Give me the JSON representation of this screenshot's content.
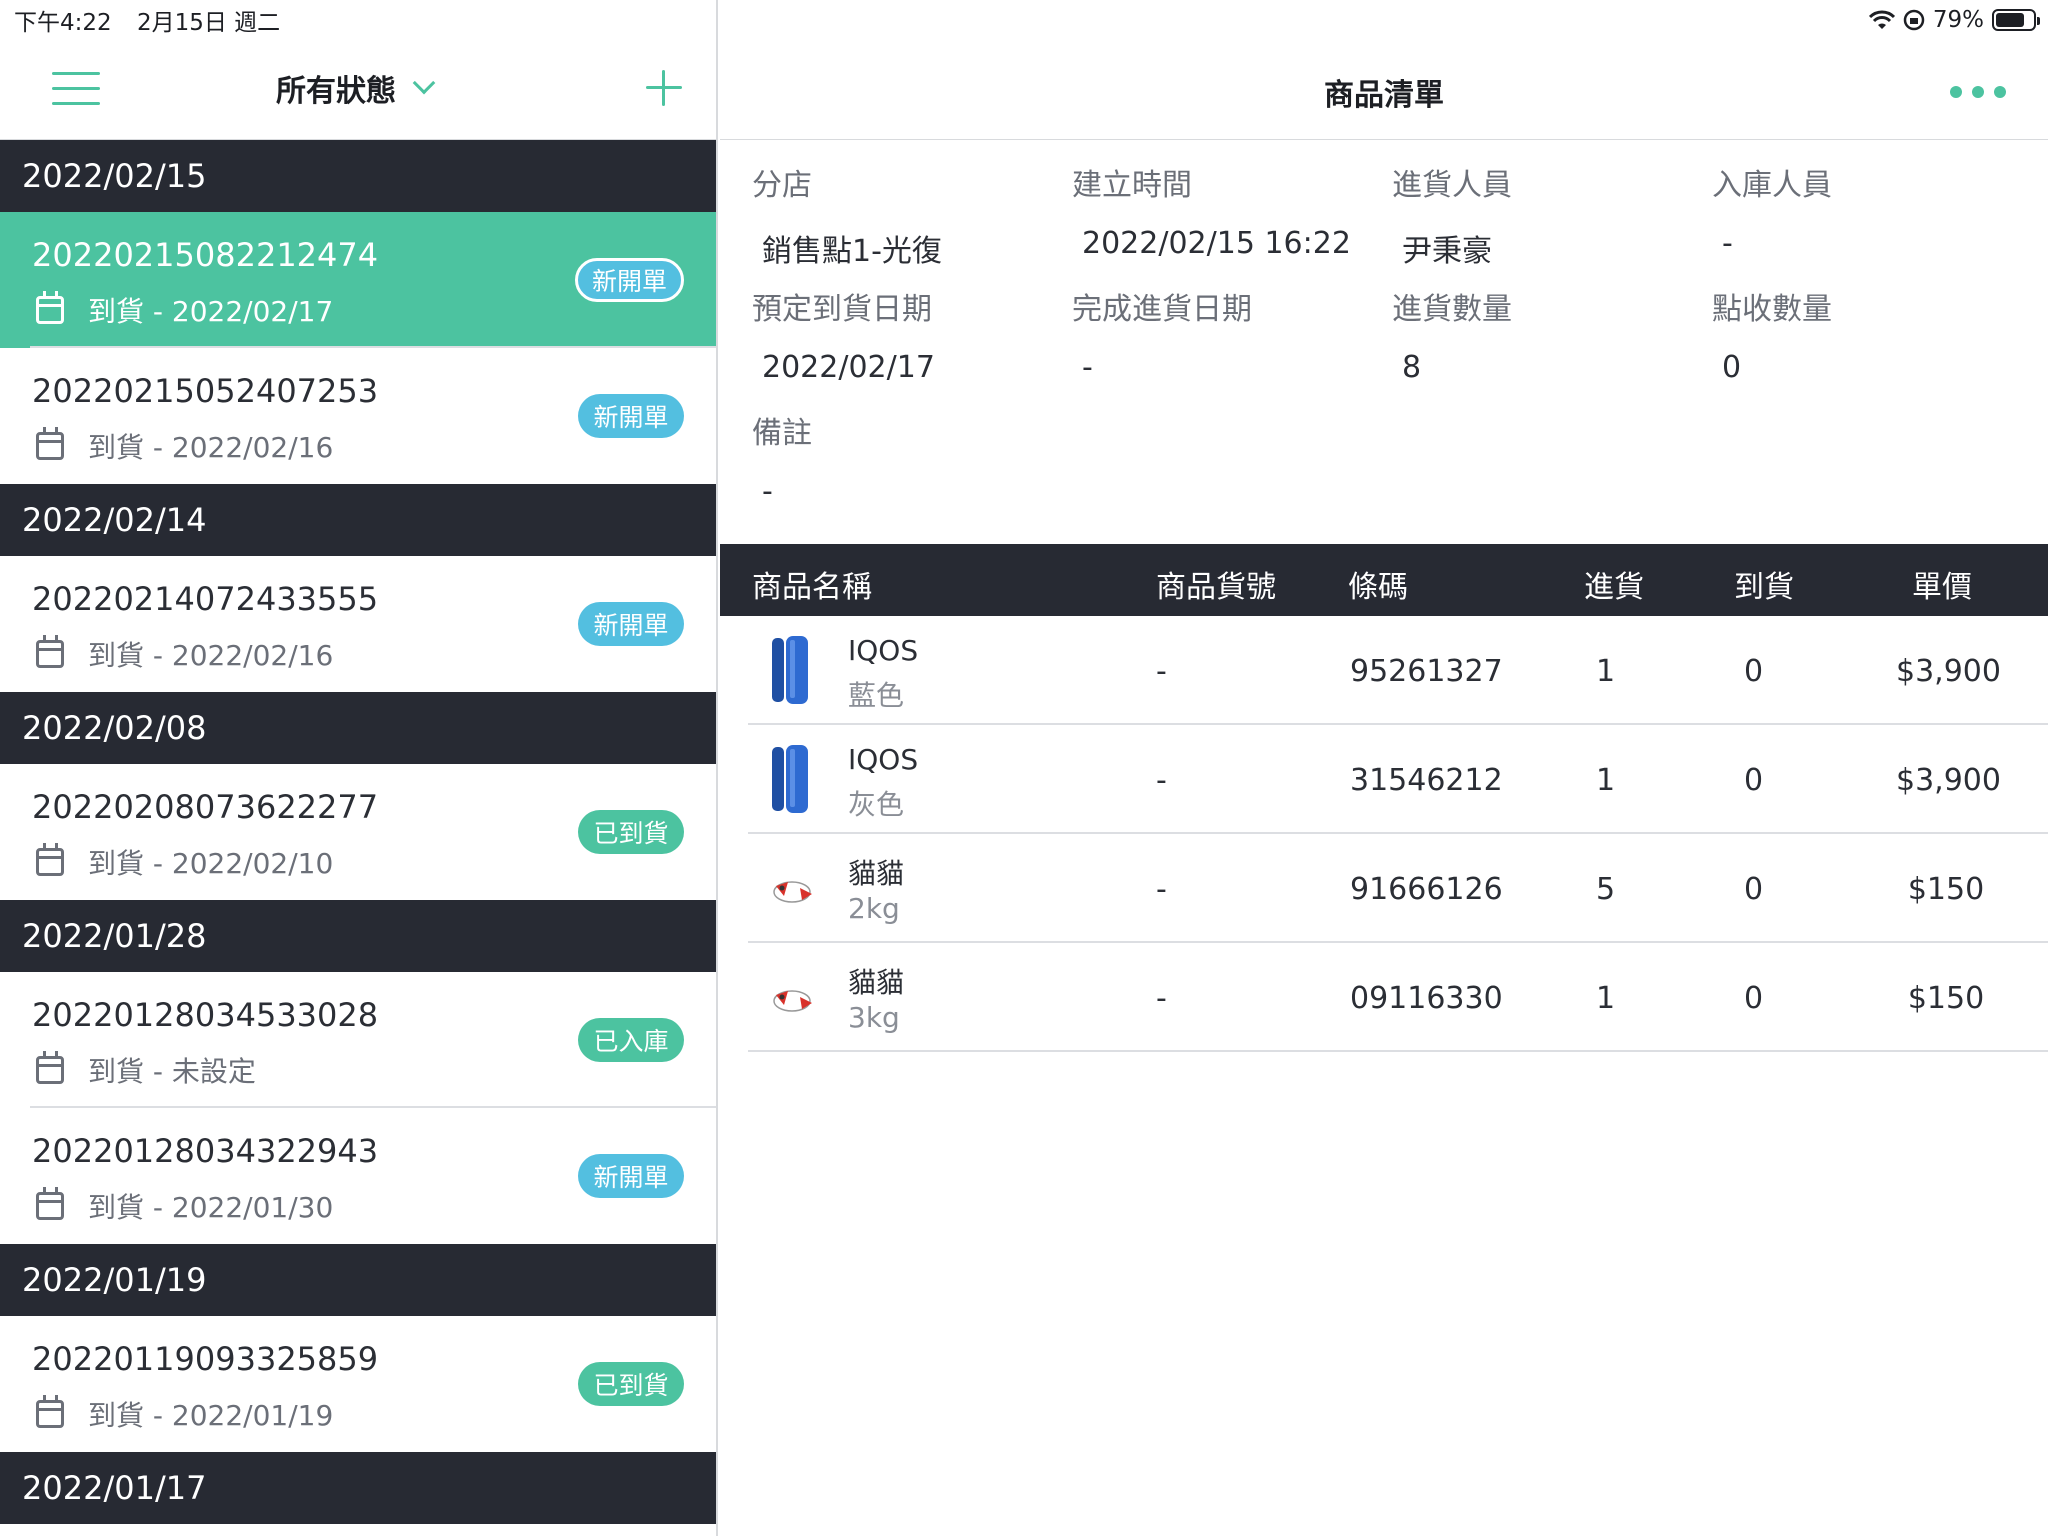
{
  "status_bar": {
    "time": "下午4:22",
    "date": "2月15日 週二",
    "battery": "79%",
    "battery_level": 0.79
  },
  "left_nav": {
    "filter_label": "所有狀態"
  },
  "orders": [
    {
      "date": "2022/02/15",
      "rows": [
        {
          "id": "20220215082212474",
          "arrival": "到貨 - 2022/02/17",
          "status": "新開單",
          "status_color": "blue",
          "selected": true
        },
        {
          "id": "20220215052407253",
          "arrival": "到貨 - 2022/02/16",
          "status": "新開單",
          "status_color": "blue"
        }
      ]
    },
    {
      "date": "2022/02/14",
      "rows": [
        {
          "id": "20220214072433555",
          "arrival": "到貨 - 2022/02/16",
          "status": "新開單",
          "status_color": "blue"
        }
      ]
    },
    {
      "date": "2022/02/08",
      "rows": [
        {
          "id": "20220208073622277",
          "arrival": "到貨 - 2022/02/10",
          "status": "已到貨",
          "status_color": "green"
        }
      ]
    },
    {
      "date": "2022/01/28",
      "rows": [
        {
          "id": "20220128034533028",
          "arrival": "到貨 - 未設定",
          "status": "已入庫",
          "status_color": "green"
        },
        {
          "id": "20220128034322943",
          "arrival": "到貨 - 2022/01/30",
          "status": "新開單",
          "status_color": "blue"
        }
      ]
    },
    {
      "date": "2022/01/19",
      "rows": [
        {
          "id": "20220119093325859",
          "arrival": "到貨 - 2022/01/19",
          "status": "已到貨",
          "status_color": "green"
        }
      ]
    },
    {
      "date": "2022/01/17",
      "rows": []
    }
  ],
  "detail": {
    "title": "商品清單",
    "info": [
      {
        "label": "分店",
        "value": "銷售點1-光復"
      },
      {
        "label": "建立時間",
        "value": "2022/02/15 16:22"
      },
      {
        "label": "進貨人員",
        "value": "尹秉豪"
      },
      {
        "label": "入庫人員",
        "value": "-"
      },
      {
        "label": "預定到貨日期",
        "value": "2022/02/17"
      },
      {
        "label": "完成進貨日期",
        "value": "-"
      },
      {
        "label": "進貨數量",
        "value": "8"
      },
      {
        "label": "點收數量",
        "value": "0"
      },
      {
        "label": "備註",
        "value": "-"
      }
    ],
    "columns": {
      "name": "商品名稱",
      "sku": "商品貨號",
      "barcode": "條碼",
      "purchase": "進貨",
      "arrival": "到貨",
      "price": "單價"
    },
    "items": [
      {
        "name": "IQOS",
        "spec": "藍色",
        "sku": "-",
        "barcode": "95261327",
        "purchase": "1",
        "arrival": "0",
        "price": "$3,900",
        "thumb": "device-icon"
      },
      {
        "name": "IQOS",
        "spec": "灰色",
        "sku": "-",
        "barcode": "31546212",
        "purchase": "1",
        "arrival": "0",
        "price": "$3,900",
        "thumb": "device-icon"
      },
      {
        "name": "貓貓",
        "spec": "2kg",
        "sku": "-",
        "barcode": "91666126",
        "purchase": "5",
        "arrival": "0",
        "price": "$150",
        "thumb": "cat-icon"
      },
      {
        "name": "貓貓",
        "spec": "3kg",
        "sku": "-",
        "barcode": "09116330",
        "purchase": "1",
        "arrival": "0",
        "price": "$150",
        "thumb": "cat-icon"
      }
    ]
  },
  "colors": {
    "accent": "#4cc3a0",
    "header_dark": "#272a33",
    "badge_blue": "#53bfe0"
  }
}
